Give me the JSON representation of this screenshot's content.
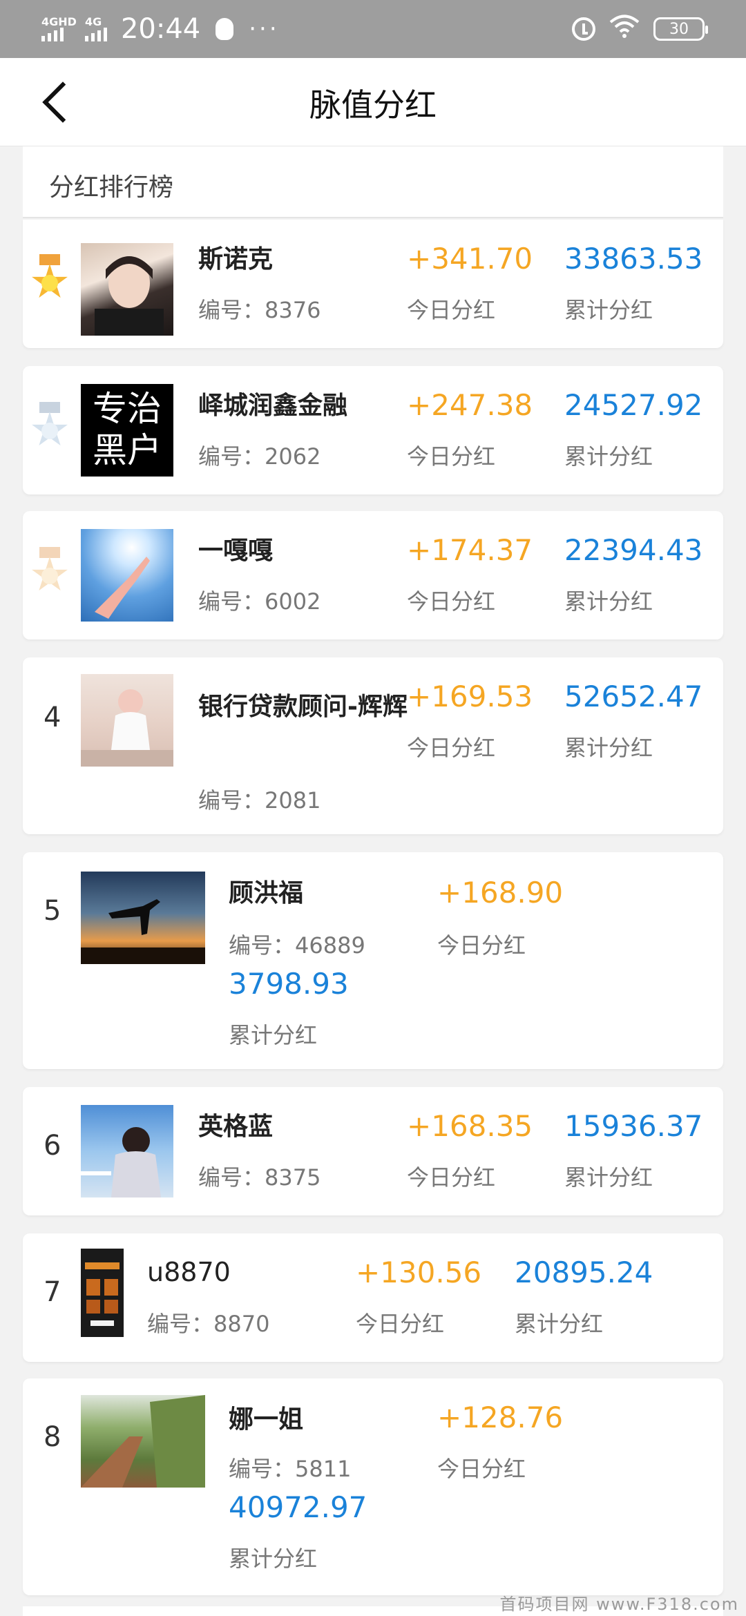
{
  "status_bar": {
    "network1": "4GHD",
    "network2": "4G",
    "time": "20:44",
    "more": "···",
    "battery": "30"
  },
  "header": {
    "title": "脉值分红"
  },
  "section": {
    "title": "分红排行榜"
  },
  "labels": {
    "today": "今日分红",
    "total": "累计分红"
  },
  "ranking": [
    {
      "rank": "1",
      "name": "斯诺克",
      "code": "编号：8376",
      "today": "+341.70",
      "total": "33863.53",
      "medal": "gold"
    },
    {
      "rank": "2",
      "name": "峄城润鑫金融",
      "code": "编号：2062",
      "today": "+247.38",
      "total": "24527.92",
      "medal": "silver",
      "avatar_text": [
        "专治",
        "黑户"
      ]
    },
    {
      "rank": "3",
      "name": "一嘎嘎",
      "code": "编号：6002",
      "today": "+174.37",
      "total": "22394.43",
      "medal": "bronze"
    },
    {
      "rank": "4",
      "name": "银行贷款顾问-辉辉",
      "code": "编号：2081",
      "today": "+169.53",
      "total": "52652.47"
    },
    {
      "rank": "5",
      "name": "顾洪福",
      "code": "编号：46889",
      "today": "+168.90",
      "total": "3798.93"
    },
    {
      "rank": "6",
      "name": "英格蓝",
      "code": "编号：8375",
      "today": "+168.35",
      "total": "15936.37"
    },
    {
      "rank": "7",
      "name": "u8870",
      "code": "编号：8870",
      "today": "+130.56",
      "total": "20895.24"
    },
    {
      "rank": "8",
      "name": "娜一姐",
      "code": "编号：5811",
      "today": "+128.76",
      "total": "40972.97"
    }
  ],
  "colors": {
    "today": "#f5a623",
    "total": "#1a82d9",
    "status_bar": "#9e9e9e"
  },
  "watermark": "首码项目网 www.F318.com"
}
